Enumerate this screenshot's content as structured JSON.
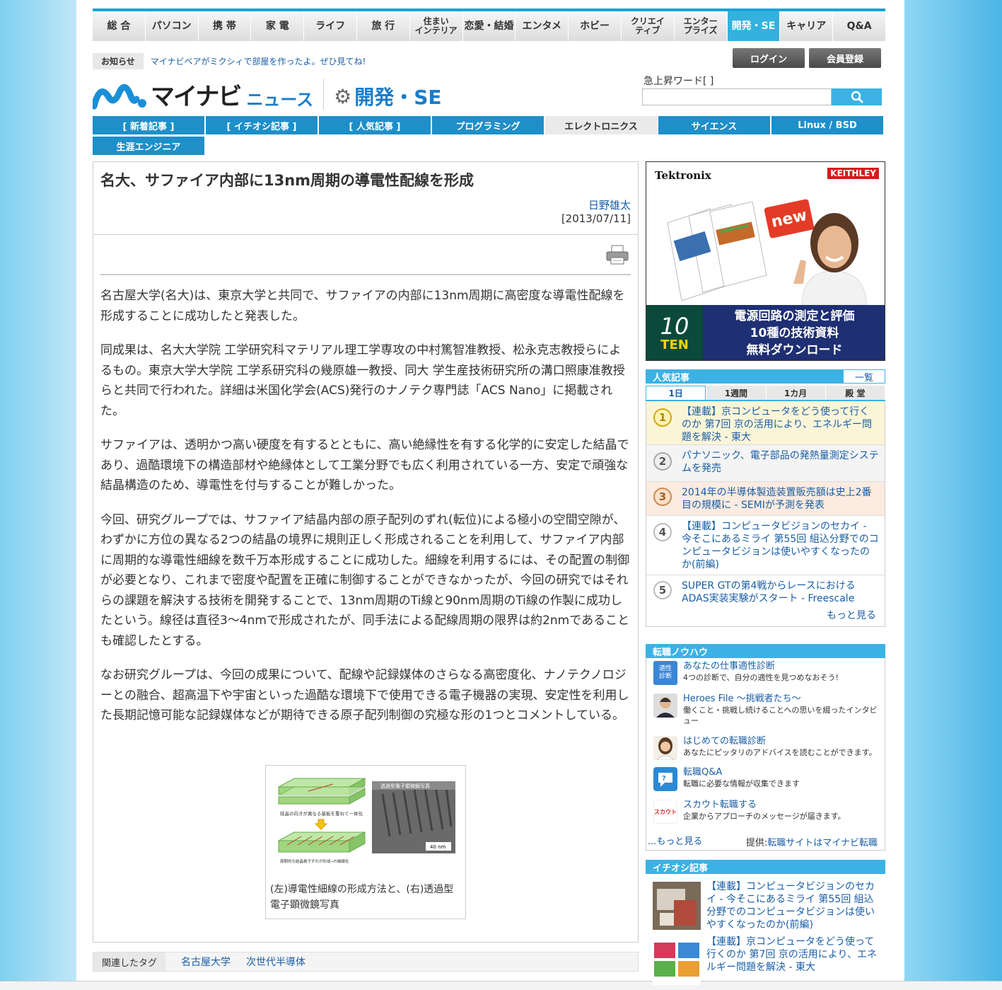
{
  "topnav": [
    "総 合",
    "パソコン",
    "携 帯",
    "家 電",
    "ライフ",
    "旅 行",
    "住まい\nインテリア",
    "恋愛・結婚",
    "エンタメ",
    "ホビー",
    "クリエイ\nティブ",
    "エンター\nプライズ",
    "開発・SE",
    "キャリア",
    "Q&A"
  ],
  "notice": {
    "label": "お知らせ",
    "text": "マイナビベアがミクシィで部屋を作ったよ。ぜひ見てね!"
  },
  "user": {
    "login": "ログイン",
    "register": "会員登録"
  },
  "logo": {
    "brand": "マイナビ",
    "news": "ニュース",
    "section": "開発・SE"
  },
  "search": {
    "surge_label": "急上昇ワード[ ]",
    "placeholder": ""
  },
  "subnav": [
    "[ 新着記事 ]",
    "[ イチオシ記事 ]",
    "[ 人気記事 ]",
    "プログラミング",
    "エレクトロニクス",
    "サイエンス",
    "Linux / BSD",
    "生涯エンジニア"
  ],
  "subnav_active": 4,
  "article": {
    "title": "名大、サファイア内部に13nm周期の導電性配線を形成",
    "author": "日野雄太",
    "date": "[2013/07/11]",
    "paragraphs": [
      "名古屋大学(名大)は、東京大学と共同で、サファイアの内部に13nm周期に高密度な導電性配線を形成することに成功したと発表した。",
      "同成果は、名大大学院 工学研究科マテリアル理工学専攻の中村篤智准教授、松永克志教授らによるもの。東京大学大学院 工学系研究科の幾原雄一教授、同大 学生産技術研究所の溝口照康准教授らと共同で行われた。詳細は米国化学会(ACS)発行のナノテク専門誌「ACS Nano」に掲載された。",
      "サファイアは、透明かつ高い硬度を有するとともに、高い絶縁性を有する化学的に安定した結晶であり、過酷環境下の構造部材や絶縁体として工業分野でも広く利用されている一方、安定で頑強な結晶構造のため、導電性を付与することが難しかった。",
      "今回、研究グループでは、サファイア結晶内部の原子配列のずれ(転位)による極小の空間空隙が、わずかに方位の異なる2つの結晶の境界に規則正しく形成されることを利用して、サファイア内部に周期的な導電性細線を数千万本形成することに成功した。細線を利用するには、その配置の制御が必要となり、これまで密度や配置を正確に制御することができなかったが、今回の研究ではそれらの課題を解決する技術を開発することで、13nm周期のTi線と90nm周期のTi線の作製に成功したという。線径は直径3～4nmで形成されたが、同手法による配線周期の限界は約2nmであることも確認したとする。",
      "なお研究グループは、今回の成果について、配線や記録媒体のさらなる高密度化、ナノテクノロジーとの融合、超高温下や宇宙といった過酷な環境下で使用できる電子機器の実現、安定性を利用した長期記憶可能な記録媒体などが期待できる原子配列制御の究極な形の1つとコメントしている。"
    ],
    "figure": {
      "caption": "(左)導電性細線の形成方法と、(右)透過型電子顕微鏡写真",
      "left_label1": "結晶の向きが異なる基板を重ねて一体化",
      "left_label2": "周期的な結晶格子ずれが形成→Ti細線化",
      "right_label": "透過型電子顕微鏡写真",
      "scale": "40 nm"
    },
    "tags_label": "関連したタグ",
    "tags": [
      "名古屋大学",
      "次世代半導体"
    ]
  },
  "ad": {
    "brand1": "Tektronix",
    "brand2": "KEITHLEY",
    "new": "new",
    "ten_num": "10",
    "ten_word": "TEN",
    "line1": "電源回路の測定と評価",
    "line2": "10種の技術資料",
    "line3": "無料ダウンロード"
  },
  "ranking": {
    "title": "人気記事",
    "all": "一覧",
    "tabs": [
      "1日",
      "1週間",
      "1カ月",
      "殿 堂"
    ],
    "items": [
      {
        "rank": "1",
        "text": "【連載】京コンピュータをどう使って行くのか 第7回 京の活用により、エネルギー問題を解決 - 東大"
      },
      {
        "rank": "2",
        "text": "パナソニック、電子部品の発熱量測定システムを発売"
      },
      {
        "rank": "3",
        "text": "2014年の半導体製造装置販売額は史上2番目の規模に - SEMIが予測を発表"
      },
      {
        "rank": "4",
        "text": "【連載】コンピュータビジョンのセカイ - 今そこにあるミライ 第55回 組込分野でのコンピュータビジョンは使いやすくなったのか(前編)"
      },
      {
        "rank": "5",
        "text": "SUPER GTの第4戦からレースにおけるADAS実装実験がスタート - Freescale"
      }
    ],
    "more": "もっと見る"
  },
  "tenshoku": {
    "title": "転職ノウハウ",
    "items": [
      {
        "title": "あなたの仕事適性診断",
        "desc": "4つの診断で、自分の適性を見つめなおそう!",
        "icon_text": "適性\n診断"
      },
      {
        "title": "Heroes File ～挑戦者たち～",
        "desc": "働くこと・挑戦し続けることへの思いを綴ったインタビュー"
      },
      {
        "title": "はじめての転職診断",
        "desc": "あなたにピッタリのアドバイスを読むことができます。"
      },
      {
        "title": "転職Q&A",
        "desc": "転職に必要な情報が収集できます"
      },
      {
        "title": "スカウト転職する",
        "desc": "企業からアプローチのメッセージが届きます。",
        "icon_text": "スカウト"
      }
    ],
    "more": "...もっと見る",
    "provided_prefix": "提供:",
    "provided_link": "転職サイトはマイナビ転職"
  },
  "ichioshi": {
    "title": "イチオシ記事",
    "items": [
      {
        "text": "【連載】コンピュータビジョンのセカイ - 今そこにあるミライ 第55回 組込分野でのコンピュータビジョンは使いやすくなったのか(前編)"
      },
      {
        "text": "【連載】京コンピュータをどう使って行くのか 第7回 京の活用により、エネルギー問題を解決 - 東大"
      }
    ]
  },
  "colors": {
    "accent": "#3cb2e4",
    "nav_blue": "#1e8fc8",
    "link": "#1a5ea5"
  }
}
